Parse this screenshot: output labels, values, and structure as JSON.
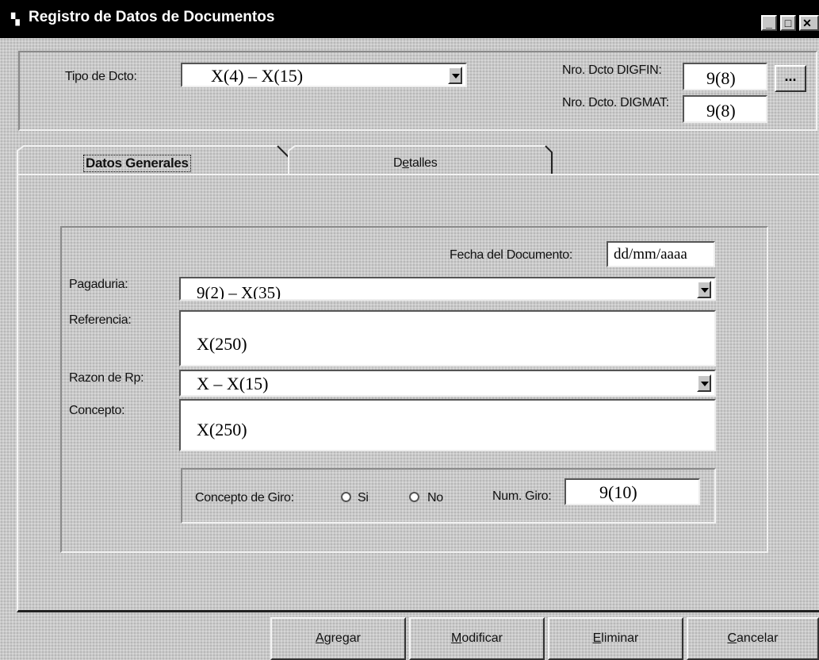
{
  "window": {
    "title": "Registro de Datos de Documentos",
    "controls": [
      "minimize",
      "maximize",
      "close"
    ]
  },
  "header": {
    "tipo_label": "Tipo de Dcto:",
    "tipo_value": "X(4) – X(15)",
    "digfin_label": "Nro. Dcto DIGFIN:",
    "digfin_value": "9(8)",
    "browse_label": "...",
    "digmat_label": "Nro. Dcto. DIGMAT:",
    "digmat_value": "9(8)"
  },
  "tabs": [
    {
      "label": "Datos Generales",
      "mnemonic": "",
      "active": true
    },
    {
      "label_pre": "D",
      "label_mn": "e",
      "label_post": "talles",
      "active": false
    }
  ],
  "form": {
    "fecha_label": "Fecha del Documento:",
    "fecha_value": "dd/mm/aaaa",
    "pagaduria_label": "Pagaduria:",
    "pagaduria_value": "9(2) – X(35)",
    "referencia_label": "Referencia:",
    "referencia_value": "X(250)",
    "razon_label": "Razon de Rp:",
    "razon_value": "X – X(15)",
    "concepto_label": "Concepto:",
    "concepto_value": "X(250)"
  },
  "giro": {
    "label": "Concepto de Giro:",
    "si": "Si",
    "no": "No",
    "num_label": "Num. Giro:",
    "num_value": "9(10)"
  },
  "buttons": {
    "agregar_mn": "A",
    "agregar_rest": "gregar",
    "modificar_mn": "M",
    "modificar_rest": "odificar",
    "eliminar_mn": "E",
    "eliminar_rest": "liminar",
    "cancelar_mn": "C",
    "cancelar_rest": "ancelar"
  }
}
